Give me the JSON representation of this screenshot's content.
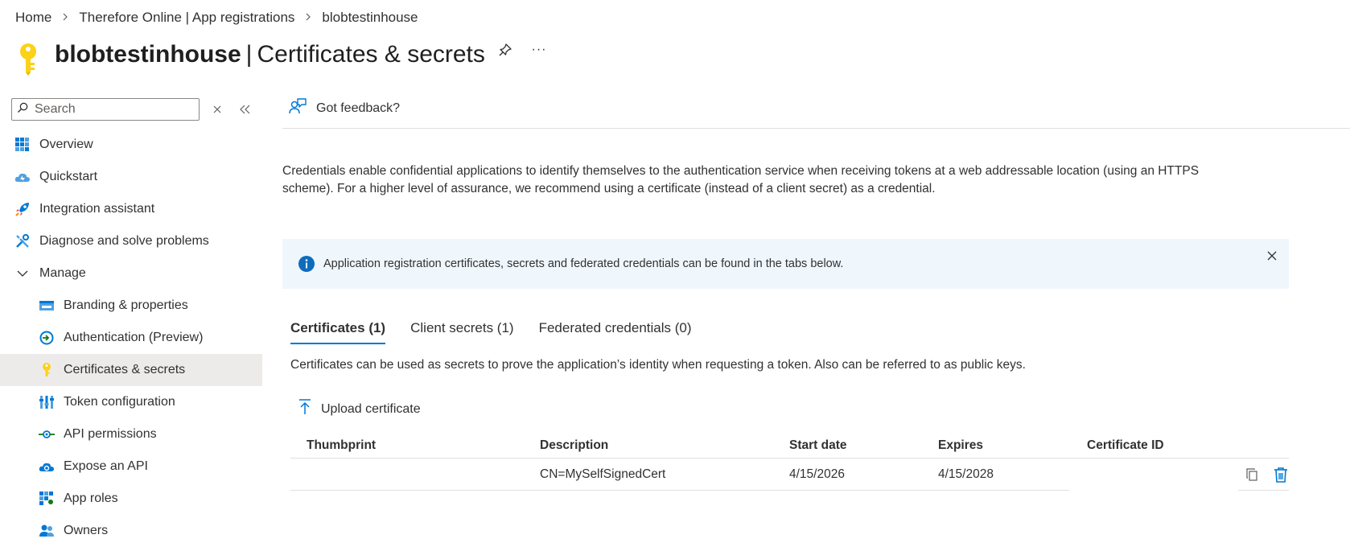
{
  "breadcrumb": {
    "items": [
      "Home",
      "Therefore Online | App registrations",
      "blobtestinhouse"
    ]
  },
  "title": {
    "resource": "blobtestinhouse",
    "separator": "|",
    "page": "Certificates & secrets",
    "pin_icon": "pin-icon",
    "more_icon": "more-icon",
    "more_label": "···"
  },
  "sidebar": {
    "search_placeholder": "Search",
    "items": [
      {
        "label": "Overview",
        "icon": "overview-grid-icon",
        "level": 1
      },
      {
        "label": "Quickstart",
        "icon": "cloud-quickstart-icon",
        "level": 1
      },
      {
        "label": "Integration assistant",
        "icon": "rocket-icon",
        "level": 1
      },
      {
        "label": "Diagnose and solve problems",
        "icon": "wrench-icon",
        "level": 1
      },
      {
        "label": "Manage",
        "icon": "chevron-down-icon",
        "level": 1
      },
      {
        "label": "Branding & properties",
        "icon": "branding-icon",
        "level": 2
      },
      {
        "label": "Authentication (Preview)",
        "icon": "authentication-icon",
        "level": 2
      },
      {
        "label": "Certificates & secrets",
        "icon": "key-icon",
        "level": 2,
        "active": true
      },
      {
        "label": "Token configuration",
        "icon": "token-bars-icon",
        "level": 2
      },
      {
        "label": "API permissions",
        "icon": "api-permissions-icon",
        "level": 2
      },
      {
        "label": "Expose an API",
        "icon": "cloud-api-icon",
        "level": 2
      },
      {
        "label": "App roles",
        "icon": "app-roles-icon",
        "level": 2
      },
      {
        "label": "Owners",
        "icon": "owners-icon",
        "level": 2
      }
    ]
  },
  "main": {
    "feedback_label": "Got feedback?",
    "intro": "Credentials enable confidential applications to identify themselves to the authentication service when receiving tokens at a web addressable location (using an HTTPS scheme). For a higher level of assurance, we recommend using a certificate (instead of a client secret) as a credential.",
    "info": "Application registration certificates, secrets and federated credentials can be found in the tabs below.",
    "tabs": [
      {
        "label": "Certificates (1)",
        "active": true
      },
      {
        "label": "Client secrets (1)",
        "active": false
      },
      {
        "label": "Federated credentials (0)",
        "active": false
      }
    ],
    "tab_description": "Certificates can be used as secrets to prove the application’s identity when requesting a token. Also can be referred to as public keys.",
    "upload_label": "Upload certificate",
    "table": {
      "headers": [
        "Thumbprint",
        "Description",
        "Start date",
        "Expires",
        "Certificate ID"
      ],
      "rows": [
        {
          "thumbprint": "",
          "description": "CN=MySelfSignedCert",
          "start": "4/15/2026",
          "expires": "4/15/2028",
          "certificate_id": ""
        }
      ]
    }
  },
  "colors": {
    "accent": "#0078d4",
    "key_yellow": "#fcd116",
    "info_bg": "#eff6fc",
    "active_nav_bg": "#edebe9"
  }
}
